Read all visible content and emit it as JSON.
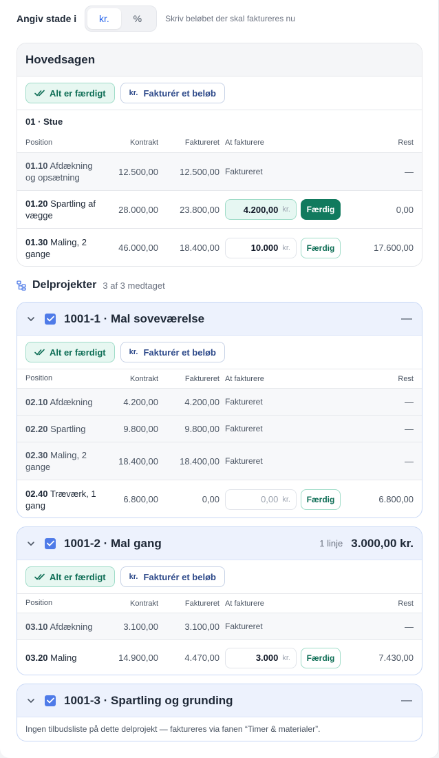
{
  "toolbar": {
    "label": "Angiv stade i",
    "options": [
      "kr.",
      "%"
    ],
    "active": "kr.",
    "hint": "Skriv beløbet der skal faktureres nu"
  },
  "table_headers": {
    "position": "Position",
    "kontrakt": "Kontrakt",
    "faktureret": "Faktureret",
    "at_fakturere": "At fakturere",
    "rest": "Rest"
  },
  "actions": {
    "all_done": "Alt er færdigt",
    "invoice_amount": "Fakturér et beløb",
    "currency_short": "kr."
  },
  "labels": {
    "done": "Færdig",
    "invoiced": "Faktureret",
    "unit": "kr.",
    "dash": "—"
  },
  "main": {
    "title": "Hovedsagen",
    "section": "01 · Stue",
    "rows": [
      {
        "code": "01.10",
        "name": "Afdækning og opsætning",
        "kontrakt": "12.500,00",
        "faktureret": "12.500,00",
        "status": "Faktureret",
        "rest": "—"
      },
      {
        "code": "01.20",
        "name": "Spartling af vægge",
        "kontrakt": "28.000,00",
        "faktureret": "23.800,00",
        "amount": "4.200,00",
        "rest": "0,00"
      },
      {
        "code": "01.30",
        "name": "Maling, 2 gange",
        "kontrakt": "46.000,00",
        "faktureret": "18.400,00",
        "amount": "10.000",
        "rest": "17.600,00"
      }
    ]
  },
  "subprojects": {
    "title": "Delprojekter",
    "count": "3 af 3 medtaget",
    "items": [
      {
        "title": "1001-1 · Mal soveværelse",
        "summary": "—",
        "rows": [
          {
            "code": "02.10",
            "name": "Afdækning",
            "kontrakt": "4.200,00",
            "faktureret": "4.200,00",
            "status": "Faktureret",
            "rest": "—"
          },
          {
            "code": "02.20",
            "name": "Spartling",
            "kontrakt": "9.800,00",
            "faktureret": "9.800,00",
            "status": "Faktureret",
            "rest": "—"
          },
          {
            "code": "02.30",
            "name": "Maling, 2 gange",
            "kontrakt": "18.400,00",
            "faktureret": "18.400,00",
            "status": "Faktureret",
            "rest": "—"
          },
          {
            "code": "02.40",
            "name": "Træværk, 1 gang",
            "kontrakt": "6.800,00",
            "faktureret": "0,00",
            "amount": "0,00",
            "rest": "6.800,00"
          }
        ]
      },
      {
        "title": "1001-2 · Mal gang",
        "lines": "1 linje",
        "total": "3.000,00 kr.",
        "rows": [
          {
            "code": "03.10",
            "name": "Afdækning",
            "kontrakt": "3.100,00",
            "faktureret": "3.100,00",
            "status": "Faktureret",
            "rest": "—"
          },
          {
            "code": "03.20",
            "name": "Maling",
            "kontrakt": "14.900,00",
            "faktureret": "4.470,00",
            "amount": "3.000",
            "rest": "7.430,00"
          }
        ]
      },
      {
        "title": "1001-3 · Spartling og grunding",
        "summary": "—",
        "note": "Ingen tilbudsliste på dette delprojekt — faktureres via fanen “Timer & materialer”."
      }
    ]
  }
}
